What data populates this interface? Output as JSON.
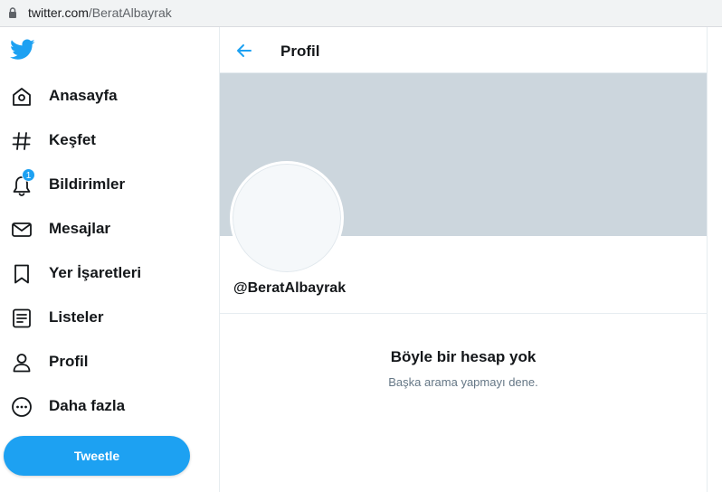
{
  "browser": {
    "url_host": "twitter.com",
    "url_path": "/BeratAlbayrak"
  },
  "sidebar": {
    "items": [
      {
        "label": "Anasayfa",
        "icon": "home-icon"
      },
      {
        "label": "Keşfet",
        "icon": "hashtag-icon"
      },
      {
        "label": "Bildirimler",
        "icon": "bell-icon",
        "badge": "1"
      },
      {
        "label": "Mesajlar",
        "icon": "envelope-icon"
      },
      {
        "label": "Yer İşaretleri",
        "icon": "bookmark-icon"
      },
      {
        "label": "Listeler",
        "icon": "list-icon"
      },
      {
        "label": "Profil",
        "icon": "person-icon"
      },
      {
        "label": "Daha fazla",
        "icon": "more-circle-icon"
      }
    ],
    "tweet_button": "Tweetle"
  },
  "header": {
    "title": "Profil"
  },
  "profile": {
    "handle": "@BeratAlbayrak"
  },
  "empty_state": {
    "title": "Böyle bir hesap yok",
    "subtitle": "Başka arama yapmayı dene."
  },
  "colors": {
    "accent": "#1da1f2",
    "banner": "#ccd6dd",
    "text": "#14171a",
    "muted": "#657786"
  }
}
